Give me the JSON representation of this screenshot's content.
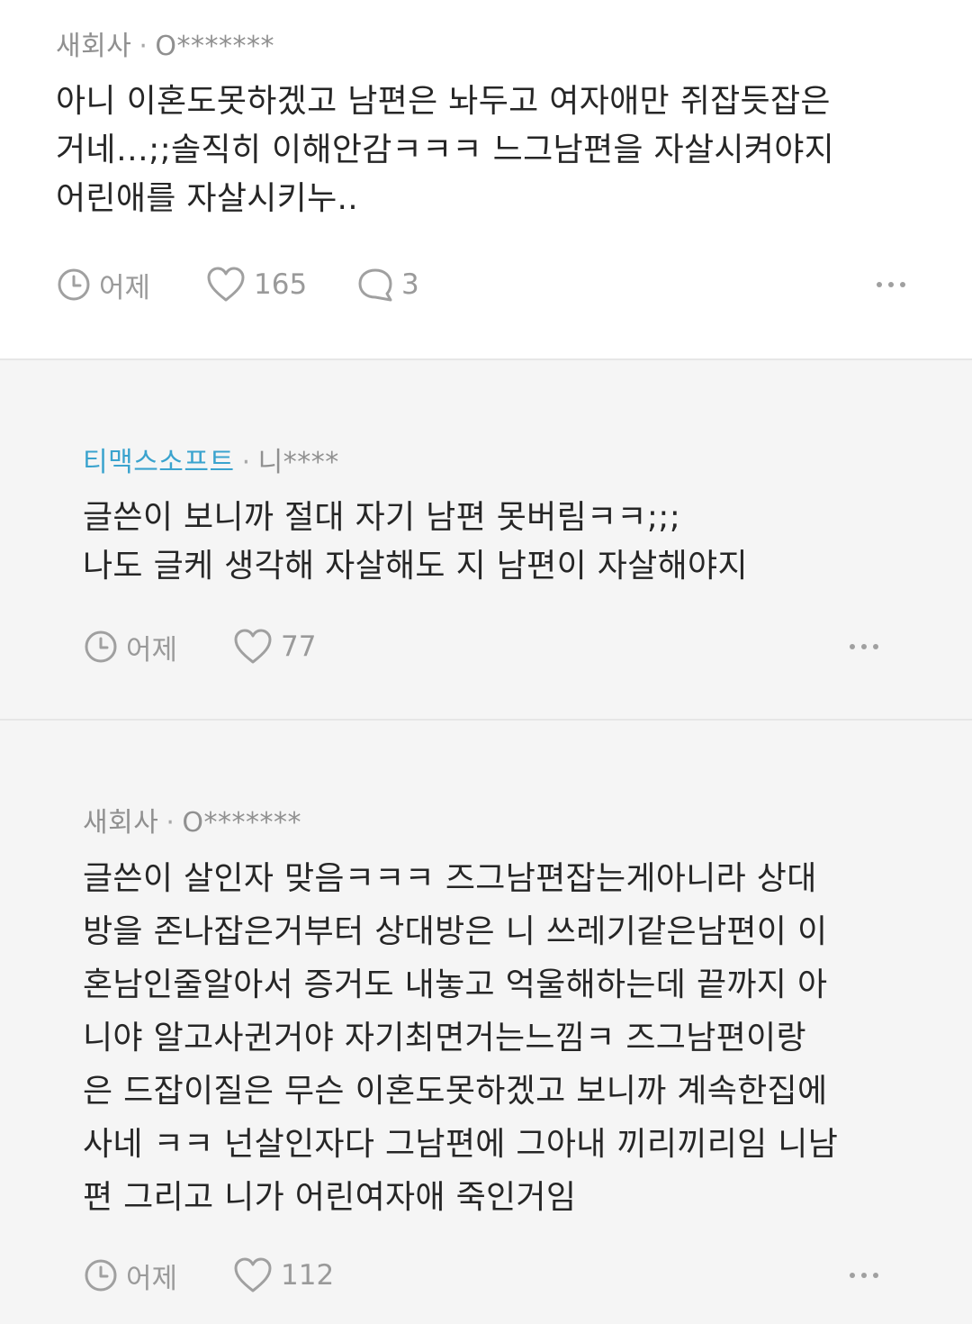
{
  "comments": [
    {
      "company": "새회사",
      "separator": "·",
      "user": "O*******",
      "lines": [
        "아니 이혼도못하겠고 남편은 놔두고 여자애만 쥐잡듯잡은",
        "거네…;;솔직히 이해안감ㅋㅋㅋ 느그남편을 자살시켜야지",
        "어린애를 자살시키누.."
      ],
      "time": "어제",
      "likes": "165",
      "replies": "3"
    },
    {
      "company": "티맥스소프트",
      "company_color": "#3aa3ce",
      "separator": "·",
      "user": "니****",
      "lines": [
        "글쓴이 보니까 절대 자기 남편 못버림ㅋㅋ;;;",
        "나도 글케 생각해 자살해도 지 남편이 자살해야지"
      ],
      "time": "어제",
      "likes": "77"
    },
    {
      "company": "새회사",
      "separator": "·",
      "user": "O*******",
      "lines": [
        "글쓴이 살인자 맞음ㅋㅋㅋ 즈그남편잡는게아니라 상대",
        "방을 존나잡은거부터 상대방은 니 쓰레기같은남편이 이",
        "혼남인줄알아서 증거도 내놓고 억울해하는데 끝까지 아",
        "니야 알고사귄거야 자기최면거는느낌ㅋ 즈그남편이랑",
        "은 드잡이질은 무슨 이혼도못하겠고 보니까 계속한집에",
        "사네 ㅋㅋ 넌살인자다 그남편에 그아내 끼리끼리임 니남",
        "편 그리고 니가 어린여자애 죽인거임"
      ],
      "time": "어제",
      "likes": "112"
    }
  ],
  "icons": {
    "time": "clock-icon",
    "like": "heart-icon",
    "reply": "speech-bubble-icon",
    "more": "more-dots-icon"
  },
  "colors": {
    "accent_company": "#3aa3ce",
    "meta_text": "#909090",
    "icon": "#9a9a9a"
  }
}
